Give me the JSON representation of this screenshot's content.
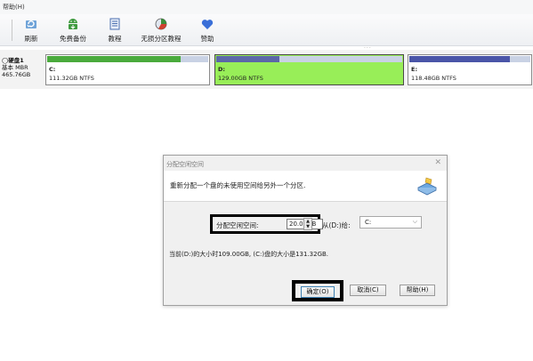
{
  "menubar": {
    "help": "帮助(H)"
  },
  "toolbar": {
    "items": [
      {
        "label": "刷新",
        "icon": "refresh-icon"
      },
      {
        "label": "免费备份",
        "icon": "android-backup-icon"
      },
      {
        "label": "教程",
        "icon": "tutorial-icon"
      },
      {
        "label": "无损分区教程",
        "icon": "partition-tutorial-icon"
      },
      {
        "label": "赞助",
        "icon": "heart-icon"
      }
    ]
  },
  "disk": {
    "name": "硬盘1",
    "type": "基本 MBR",
    "size": "465.76GB",
    "partitions": [
      {
        "name": "C:",
        "info": "111.32GB NTFS",
        "used_fraction": 0.83,
        "color": "#4aaa3c"
      },
      {
        "name": "D:",
        "info": "129.00GB NTFS",
        "used_fraction": 0.34,
        "color": "#5b67a8"
      },
      {
        "name": "E:",
        "info": "118.48GB NTFS",
        "used_fraction": 0.83,
        "color": "#4a55a8"
      }
    ]
  },
  "dialog": {
    "title": "分配空闲空间",
    "description": "重新分配一个盘的未使用空间给另外一个分区.",
    "alloc_label": "分配空闲空间:",
    "alloc_value": "20.00GB",
    "from_label": "从(D:)给:",
    "from_value": "C:",
    "size_info": "当前(D:)的大小时109.00GB, (C:)盘的大小是131.32GB.",
    "buttons": {
      "ok": "确定(O)",
      "cancel": "取消(C)",
      "help": "帮助(H)"
    }
  },
  "colors": {
    "selected_partition": "#98ee58",
    "highlight_border": "#000000"
  }
}
